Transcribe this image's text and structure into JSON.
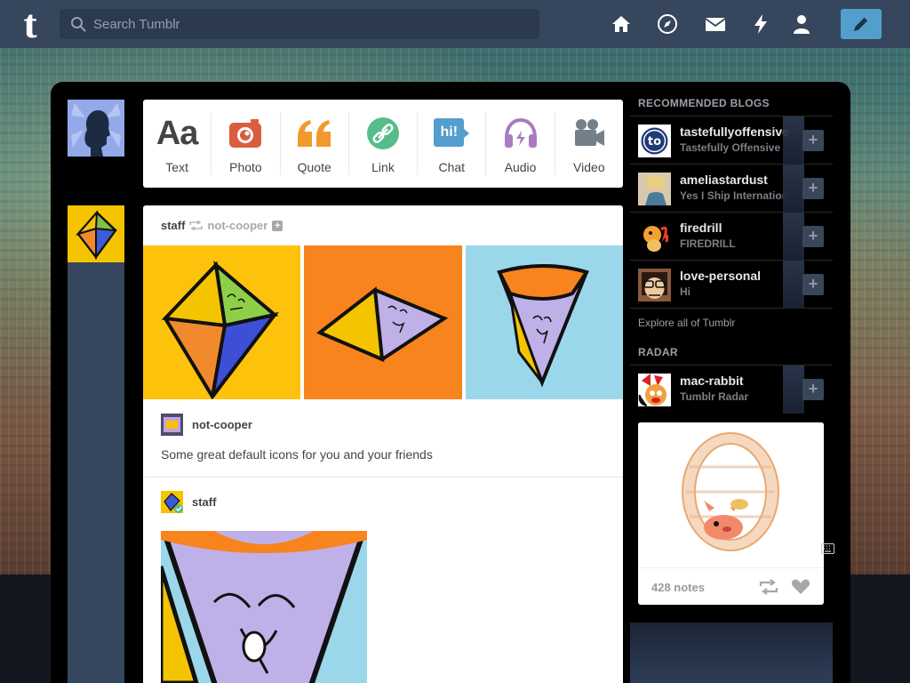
{
  "topbar": {
    "logo": "t",
    "search_placeholder": "Search Tumblr",
    "nav": [
      "home-icon",
      "explore-compass-icon",
      "inbox-mail-icon",
      "activity-lightning-icon",
      "account-person-icon"
    ],
    "compose": "compose-pencil-icon"
  },
  "colors": {
    "navy": "#36465d",
    "accent_blue": "#529ecc",
    "text_photo": "#d95e40",
    "quote": "#f2992e",
    "link": "#56bc8a",
    "chat": "#529ecc",
    "audio": "#a77dc2",
    "video": "#748089"
  },
  "post_types": [
    {
      "label": "Text",
      "icon": "text-aa-icon",
      "glyph": "Aa"
    },
    {
      "label": "Photo",
      "icon": "photo-camera-icon"
    },
    {
      "label": "Quote",
      "icon": "quote-marks-icon"
    },
    {
      "label": "Link",
      "icon": "link-chain-icon"
    },
    {
      "label": "Chat",
      "icon": "chat-bubble-icon",
      "glyph": "hi!"
    },
    {
      "label": "Audio",
      "icon": "audio-headphones-icon"
    },
    {
      "label": "Video",
      "icon": "video-camera-icon"
    }
  ],
  "post": {
    "author": "staff",
    "reblogged_from": "not-cooper",
    "reblog_author": "not-cooper",
    "caption": "Some great default icons for you and your friends",
    "second_author": "staff"
  },
  "sidebar": {
    "recommended_title": "RECOMMENDED BLOGS",
    "blogs": [
      {
        "name": "tastefullyoffensive",
        "subtitle": "Tastefully Offensive",
        "icon": "to-logo-avatar"
      },
      {
        "name": "ameliastardust",
        "subtitle": "Yes I Ship Internation",
        "icon": "photo-avatar"
      },
      {
        "name": "firedrill",
        "subtitle": "FIREDRILL",
        "icon": "flame-creature-avatar"
      },
      {
        "name": "love-personal",
        "subtitle": "Hi",
        "icon": "cartoon-girl-avatar"
      }
    ],
    "explore": "Explore all of Tumblr",
    "radar_title": "RADAR",
    "radar_blog": {
      "name": "mac-rabbit",
      "subtitle": "Tumblr Radar"
    },
    "notes": "428 notes",
    "follow_glyph": "+"
  }
}
